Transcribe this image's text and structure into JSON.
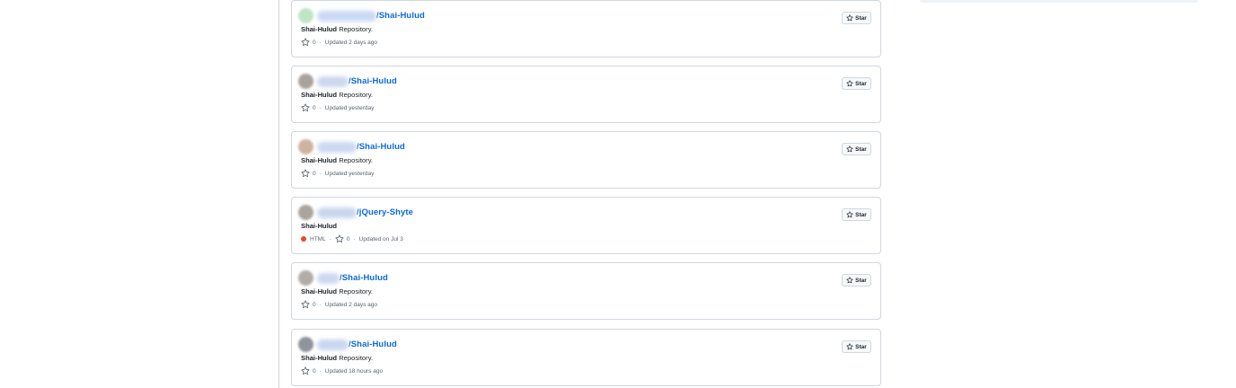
{
  "repos": [
    {
      "avatar_color": "#bfe6c4",
      "owner_blur_color": "#c9d9f3",
      "name": "/Shai-Hulud",
      "desc_bold": "Shai-Hulud",
      "desc_rest": " Repository.",
      "language": "",
      "language_color": "",
      "stars": "0",
      "sep": "·",
      "updated": "Updated 2 days ago",
      "star_label": "Star"
    },
    {
      "avatar_color": "#a9a29c",
      "owner_blur_color": "#ccd8ef",
      "name": "/Shai-Hulud",
      "desc_bold": "Shai-Hulud",
      "desc_rest": " Repository.",
      "language": "",
      "language_color": "",
      "stars": "0",
      "sep": "·",
      "updated": "Updated yesterday",
      "star_label": "Star"
    },
    {
      "avatar_color": "#cfb3a1",
      "owner_blur_color": "#ccd8ef",
      "name": "/Shai-Hulud",
      "desc_bold": "Shai-Hulud",
      "desc_rest": " Repository.",
      "language": "",
      "language_color": "",
      "stars": "0",
      "sep": "·",
      "updated": "Updated yesterday",
      "star_label": "Star"
    },
    {
      "avatar_color": "#aaa49e",
      "owner_blur_color": "#c9d6f0",
      "name": "/jQuery-Shyte",
      "desc_bold": "Shai-Hulud",
      "desc_rest": "",
      "language": "HTML",
      "language_color": "#e34c26",
      "stars": "0",
      "sep": "·",
      "updated": "Updated on Jul 3",
      "star_label": "Star"
    },
    {
      "avatar_color": "#b1aca8",
      "owner_blur_color": "#ccd8ef",
      "name": "/Shai-Hulud",
      "desc_bold": "Shai-Hulud",
      "desc_rest": " Repository.",
      "language": "",
      "language_color": "",
      "stars": "0",
      "sep": "·",
      "updated": "Updated 2 days ago",
      "star_label": "Star"
    },
    {
      "avatar_color": "#8f939a",
      "owner_blur_color": "#c9d6f0",
      "name": "/Shai-Hulud",
      "desc_bold": "Shai-Hulud",
      "desc_rest": " Repository.",
      "language": "",
      "language_color": "",
      "stars": "0",
      "sep": "·",
      "updated": "Updated 18 hours ago",
      "star_label": "Star"
    }
  ]
}
